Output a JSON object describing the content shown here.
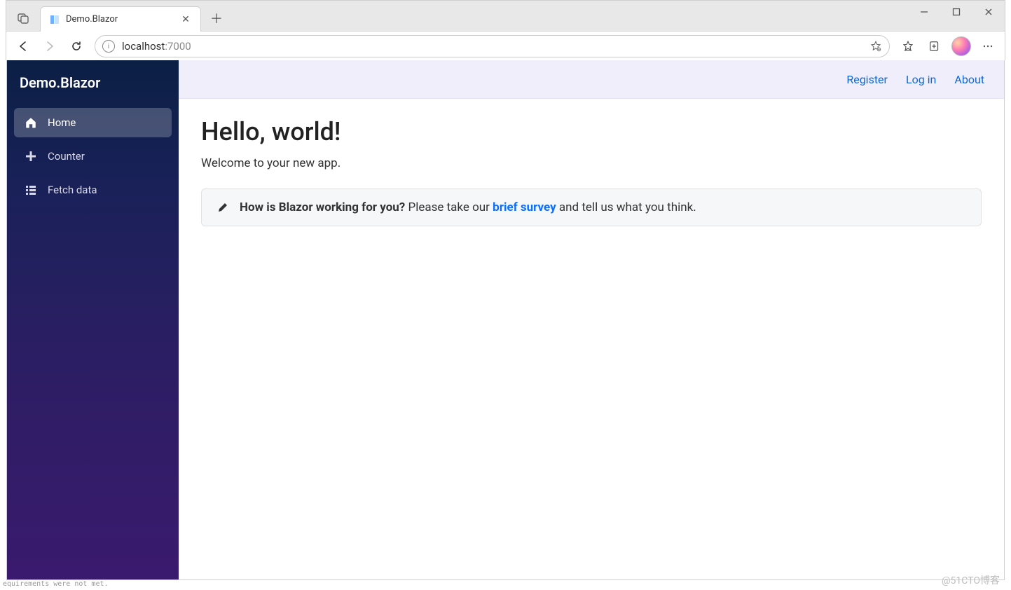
{
  "browser": {
    "tab_title": "Demo.Blazor",
    "url_host": "localhost",
    "url_port": ":7000"
  },
  "sidebar": {
    "brand": "Demo.Blazor",
    "items": [
      {
        "label": "Home",
        "icon": "home-icon",
        "active": true
      },
      {
        "label": "Counter",
        "icon": "plus-icon",
        "active": false
      },
      {
        "label": "Fetch data",
        "icon": "list-icon",
        "active": false
      }
    ]
  },
  "topbar": {
    "links": [
      "Register",
      "Log in",
      "About"
    ]
  },
  "content": {
    "heading": "Hello, world!",
    "subtitle": "Welcome to your new app.",
    "survey_bold": "How is Blazor working for you?",
    "survey_before": " Please take our ",
    "survey_link": "brief survey",
    "survey_after": " and tell us what you think."
  },
  "watermark": "@51CTO博客",
  "footer_text": "equirements were not met."
}
